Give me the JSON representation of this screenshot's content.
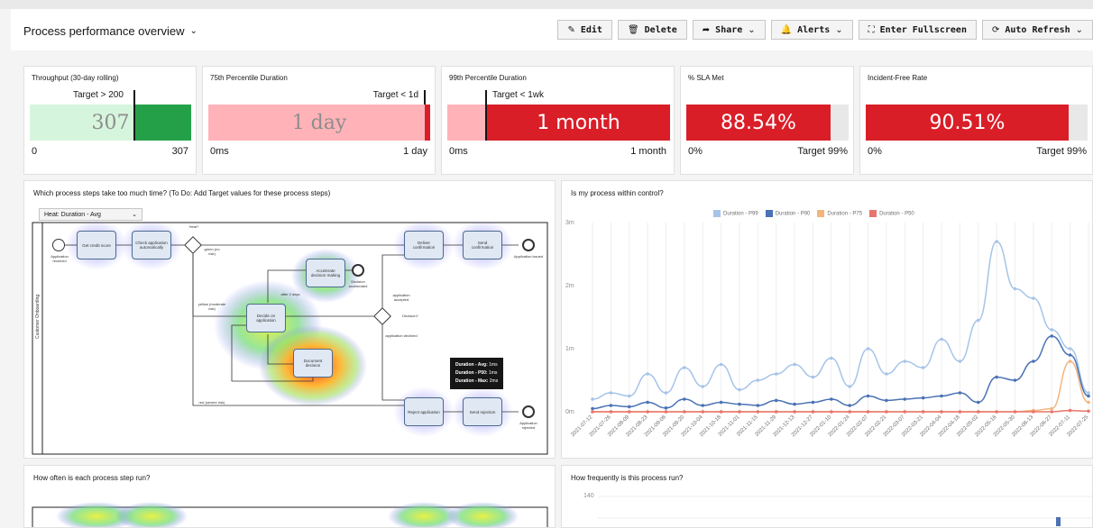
{
  "header": {
    "title": "Process performance overview",
    "buttons": {
      "edit": "Edit",
      "delete": "Delete",
      "share": "Share",
      "alerts": "Alerts",
      "fullscreen": "Enter Fullscreen",
      "auto_refresh": "Auto Refresh"
    }
  },
  "kpis": {
    "throughput": {
      "title": "Throughput (30-day rolling)",
      "target": "Target > 200",
      "value": "307",
      "min": "0",
      "max": "307"
    },
    "p75": {
      "title": "75th Percentile Duration",
      "target": "Target < 1d",
      "value": "1 day",
      "min": "0ms",
      "max": "1 day"
    },
    "p99": {
      "title": "99th Percentile Duration",
      "target": "Target < 1wk",
      "value": "1 month",
      "min": "0ms",
      "max": "1 month"
    },
    "sla": {
      "title": "% SLA Met",
      "value": "88.54%",
      "min": "0%",
      "max": "Target 99%",
      "fill": 0.8854
    },
    "incident": {
      "title": "Incident-Free Rate",
      "value": "90.51%",
      "min": "0%",
      "max": "Target 99%",
      "fill": 0.9051
    }
  },
  "heatmap_panel": {
    "title": "Which process steps take too much time? (To Do: Add Target values for these process steps)",
    "select_value": "Heat: Duration - Avg",
    "lane_label": "Customer Onboarding",
    "nodes": {
      "start": "Application received",
      "credit": "Get credit score",
      "check": "Check application automatically",
      "heat": "Heat?",
      "green": "green (no risk)",
      "deliver": "Deliver confirmation",
      "send_conf": "Send confirmation",
      "end_issued": "Application issued",
      "accelerate": "Accelerate decision making",
      "decision_acc": "Decision accelerated",
      "after2": "after 2 days",
      "yellow": "yellow (moderate risk)",
      "decide": "Decide on application",
      "accepted": "application accepted",
      "decision": "Decision?",
      "declined": "application declined",
      "doc": "Document decision",
      "red": "red (severe risk)",
      "reject": "Reject application",
      "send_rej": "Send rejection",
      "end_rej": "Application rejected"
    },
    "tooltip": {
      "avg": "Duration - Avg:",
      "avg_v": "1ms",
      "p50": "Duration - P50:",
      "p50_v": "1ms",
      "max": "Duration - Max:",
      "max_v": "2ms"
    }
  },
  "control_panel": {
    "title": "Is my process within control?"
  },
  "chart_data": {
    "type": "line",
    "title": "",
    "ylabel": "",
    "ylim": [
      0,
      3
    ],
    "yticks": [
      "0m",
      "1m",
      "2m",
      "3m"
    ],
    "x": [
      "2021-07-12",
      "2021-07-26",
      "2021-08-09",
      "2021-08-23",
      "2021-09-06",
      "2021-09-20",
      "2021-10-04",
      "2021-10-18",
      "2021-11-01",
      "2021-11-15",
      "2021-11-29",
      "2021-12-13",
      "2021-12-27",
      "2022-01-10",
      "2022-01-24",
      "2022-02-07",
      "2022-02-21",
      "2022-03-07",
      "2022-03-21",
      "2022-04-04",
      "2022-04-18",
      "2022-05-02",
      "2022-05-16",
      "2022-05-30",
      "2022-06-13",
      "2022-06-27",
      "2022-07-11",
      "2022-07-25"
    ],
    "series": [
      {
        "name": "Duration - P99",
        "color": "#a6c4e8",
        "values": [
          0.2,
          0.3,
          0.25,
          0.6,
          0.3,
          0.7,
          0.4,
          0.75,
          0.35,
          0.5,
          0.6,
          0.75,
          0.55,
          0.85,
          0.4,
          1.0,
          0.6,
          0.8,
          0.7,
          1.15,
          0.8,
          1.45,
          2.7,
          1.95,
          1.8,
          1.3,
          1.0,
          0.3
        ]
      },
      {
        "name": "Duration - P90",
        "color": "#4a72b5",
        "values": [
          0.05,
          0.1,
          0.08,
          0.15,
          0.06,
          0.2,
          0.1,
          0.15,
          0.12,
          0.1,
          0.18,
          0.12,
          0.15,
          0.2,
          0.1,
          0.25,
          0.18,
          0.2,
          0.22,
          0.25,
          0.3,
          0.15,
          0.55,
          0.5,
          0.8,
          1.2,
          0.9,
          0.25
        ]
      },
      {
        "name": "Duration - P75",
        "color": "#f3b57c",
        "values": [
          0,
          0,
          0,
          0,
          0,
          0,
          0,
          0,
          0,
          0,
          0,
          0,
          0,
          0,
          0,
          0,
          0,
          0,
          0,
          0,
          0,
          0,
          0,
          0,
          0.02,
          0.05,
          0.8,
          0.15
        ]
      },
      {
        "name": "Duration - P50",
        "color": "#e8756c",
        "values": [
          0,
          0,
          0,
          0,
          0,
          0,
          0,
          0,
          0,
          0,
          0,
          0,
          0,
          0,
          0,
          0,
          0,
          0,
          0,
          0,
          0,
          0,
          0,
          0,
          0,
          0,
          0.02,
          0.01
        ]
      }
    ]
  },
  "bottom_left": {
    "title": "How often is each process step run?"
  },
  "bottom_right": {
    "title": "How frequently is this process run?",
    "ytick": "140"
  },
  "colors": {
    "green_fill": "#24a148",
    "green_bg": "#d6f5dd",
    "red": "#da1e28",
    "red_bg": "#ffb3b8",
    "grey": "#e8e8e8"
  }
}
